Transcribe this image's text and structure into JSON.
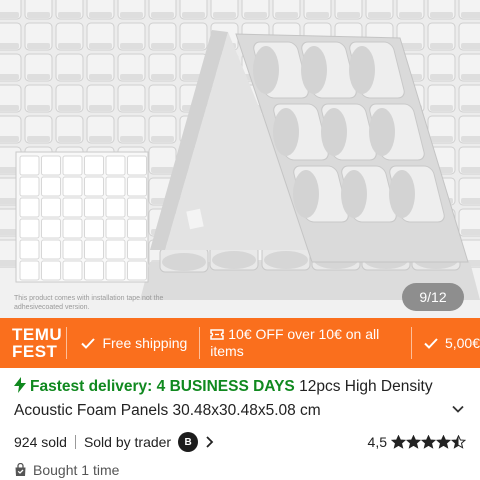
{
  "gallery": {
    "disclaimer": "This product comes with installation tape not the adhesivecoated version.",
    "counter": "9/12"
  },
  "promo": {
    "brand_line1": "TEMU",
    "brand_line2": "FEST",
    "free_shipping": "Free shipping",
    "coupon": "10€ OFF over 10€ on all items",
    "next_offer": "5,00€",
    "colors": {
      "bar": "#fa6f1d",
      "text": "#ffffff"
    }
  },
  "product": {
    "delivery": "Fastest delivery: 4 BUSINESS DAYS",
    "title": "12pcs High Density Acoustic Foam Panels 30.48x30.48x5.08 cm",
    "sold": "924 sold",
    "seller": "Sold by trader",
    "rating": "4,5",
    "stars_value": 4.5,
    "bought": "Bought 1 time",
    "colors": {
      "delivery": "#10891f"
    }
  }
}
